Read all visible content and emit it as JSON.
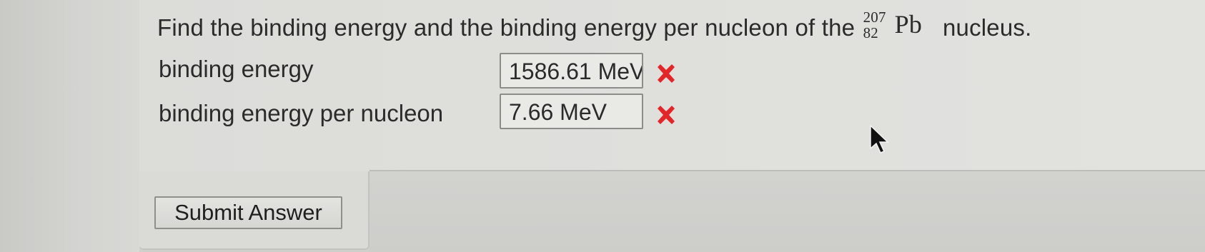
{
  "question": {
    "prefix": "Find the binding energy and the binding energy per nucleon of the",
    "nuclide": {
      "mass_number": "207",
      "atomic_number": "82",
      "symbol": "Pb"
    },
    "suffix": "nucleus."
  },
  "rows": [
    {
      "label": "binding energy",
      "value": "1586.61 MeV",
      "status": "incorrect",
      "status_icon": "red-x-icon"
    },
    {
      "label": "binding energy per nucleon",
      "value": "7.66 MeV",
      "status": "incorrect",
      "status_icon": "red-x-icon"
    }
  ],
  "submit_button": {
    "label": "Submit Answer"
  },
  "colors": {
    "incorrect": "#e2262a",
    "text": "#2b2b2b"
  }
}
